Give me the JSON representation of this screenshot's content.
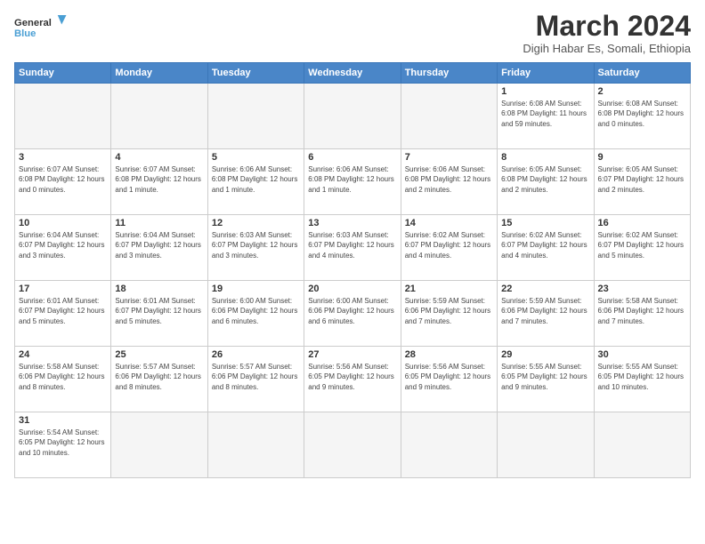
{
  "logo": {
    "text_general": "General",
    "text_blue": "Blue"
  },
  "title": {
    "month_year": "March 2024",
    "location": "Digih Habar Es, Somali, Ethiopia"
  },
  "days_of_week": [
    "Sunday",
    "Monday",
    "Tuesday",
    "Wednesday",
    "Thursday",
    "Friday",
    "Saturday"
  ],
  "weeks": [
    [
      {
        "day": "",
        "empty": true
      },
      {
        "day": "",
        "empty": true
      },
      {
        "day": "",
        "empty": true
      },
      {
        "day": "",
        "empty": true
      },
      {
        "day": "",
        "empty": true
      },
      {
        "day": "1",
        "info": "Sunrise: 6:08 AM\nSunset: 6:08 PM\nDaylight: 11 hours\nand 59 minutes."
      },
      {
        "day": "2",
        "info": "Sunrise: 6:08 AM\nSunset: 6:08 PM\nDaylight: 12 hours\nand 0 minutes."
      }
    ],
    [
      {
        "day": "3",
        "info": "Sunrise: 6:07 AM\nSunset: 6:08 PM\nDaylight: 12 hours\nand 0 minutes."
      },
      {
        "day": "4",
        "info": "Sunrise: 6:07 AM\nSunset: 6:08 PM\nDaylight: 12 hours\nand 1 minute."
      },
      {
        "day": "5",
        "info": "Sunrise: 6:06 AM\nSunset: 6:08 PM\nDaylight: 12 hours\nand 1 minute."
      },
      {
        "day": "6",
        "info": "Sunrise: 6:06 AM\nSunset: 6:08 PM\nDaylight: 12 hours\nand 1 minute."
      },
      {
        "day": "7",
        "info": "Sunrise: 6:06 AM\nSunset: 6:08 PM\nDaylight: 12 hours\nand 2 minutes."
      },
      {
        "day": "8",
        "info": "Sunrise: 6:05 AM\nSunset: 6:08 PM\nDaylight: 12 hours\nand 2 minutes."
      },
      {
        "day": "9",
        "info": "Sunrise: 6:05 AM\nSunset: 6:07 PM\nDaylight: 12 hours\nand 2 minutes."
      }
    ],
    [
      {
        "day": "10",
        "info": "Sunrise: 6:04 AM\nSunset: 6:07 PM\nDaylight: 12 hours\nand 3 minutes."
      },
      {
        "day": "11",
        "info": "Sunrise: 6:04 AM\nSunset: 6:07 PM\nDaylight: 12 hours\nand 3 minutes."
      },
      {
        "day": "12",
        "info": "Sunrise: 6:03 AM\nSunset: 6:07 PM\nDaylight: 12 hours\nand 3 minutes."
      },
      {
        "day": "13",
        "info": "Sunrise: 6:03 AM\nSunset: 6:07 PM\nDaylight: 12 hours\nand 4 minutes."
      },
      {
        "day": "14",
        "info": "Sunrise: 6:02 AM\nSunset: 6:07 PM\nDaylight: 12 hours\nand 4 minutes."
      },
      {
        "day": "15",
        "info": "Sunrise: 6:02 AM\nSunset: 6:07 PM\nDaylight: 12 hours\nand 4 minutes."
      },
      {
        "day": "16",
        "info": "Sunrise: 6:02 AM\nSunset: 6:07 PM\nDaylight: 12 hours\nand 5 minutes."
      }
    ],
    [
      {
        "day": "17",
        "info": "Sunrise: 6:01 AM\nSunset: 6:07 PM\nDaylight: 12 hours\nand 5 minutes."
      },
      {
        "day": "18",
        "info": "Sunrise: 6:01 AM\nSunset: 6:07 PM\nDaylight: 12 hours\nand 5 minutes."
      },
      {
        "day": "19",
        "info": "Sunrise: 6:00 AM\nSunset: 6:06 PM\nDaylight: 12 hours\nand 6 minutes."
      },
      {
        "day": "20",
        "info": "Sunrise: 6:00 AM\nSunset: 6:06 PM\nDaylight: 12 hours\nand 6 minutes."
      },
      {
        "day": "21",
        "info": "Sunrise: 5:59 AM\nSunset: 6:06 PM\nDaylight: 12 hours\nand 7 minutes."
      },
      {
        "day": "22",
        "info": "Sunrise: 5:59 AM\nSunset: 6:06 PM\nDaylight: 12 hours\nand 7 minutes."
      },
      {
        "day": "23",
        "info": "Sunrise: 5:58 AM\nSunset: 6:06 PM\nDaylight: 12 hours\nand 7 minutes."
      }
    ],
    [
      {
        "day": "24",
        "info": "Sunrise: 5:58 AM\nSunset: 6:06 PM\nDaylight: 12 hours\nand 8 minutes."
      },
      {
        "day": "25",
        "info": "Sunrise: 5:57 AM\nSunset: 6:06 PM\nDaylight: 12 hours\nand 8 minutes."
      },
      {
        "day": "26",
        "info": "Sunrise: 5:57 AM\nSunset: 6:06 PM\nDaylight: 12 hours\nand 8 minutes."
      },
      {
        "day": "27",
        "info": "Sunrise: 5:56 AM\nSunset: 6:05 PM\nDaylight: 12 hours\nand 9 minutes."
      },
      {
        "day": "28",
        "info": "Sunrise: 5:56 AM\nSunset: 6:05 PM\nDaylight: 12 hours\nand 9 minutes."
      },
      {
        "day": "29",
        "info": "Sunrise: 5:55 AM\nSunset: 6:05 PM\nDaylight: 12 hours\nand 9 minutes."
      },
      {
        "day": "30",
        "info": "Sunrise: 5:55 AM\nSunset: 6:05 PM\nDaylight: 12 hours\nand 10 minutes."
      }
    ],
    [
      {
        "day": "31",
        "info": "Sunrise: 5:54 AM\nSunset: 6:05 PM\nDaylight: 12 hours\nand 10 minutes."
      },
      {
        "day": "",
        "empty": true
      },
      {
        "day": "",
        "empty": true
      },
      {
        "day": "",
        "empty": true
      },
      {
        "day": "",
        "empty": true
      },
      {
        "day": "",
        "empty": true
      },
      {
        "day": "",
        "empty": true
      }
    ]
  ]
}
